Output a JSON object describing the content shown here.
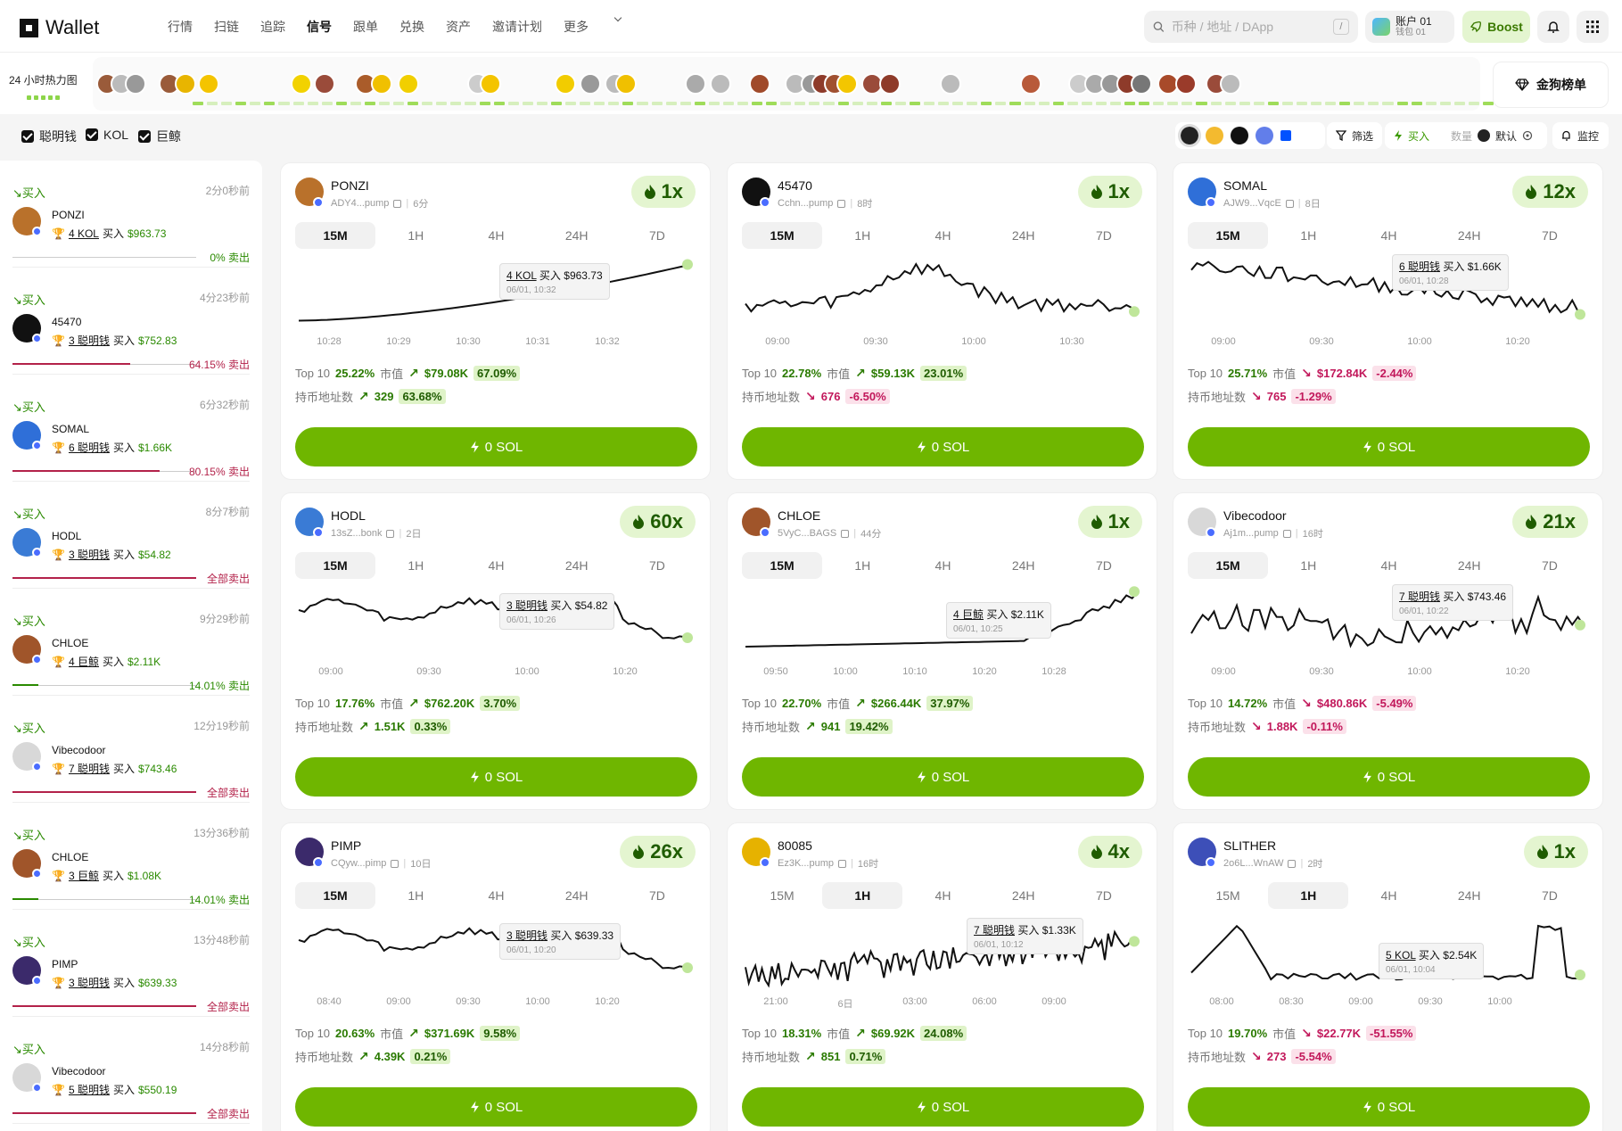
{
  "header": {
    "logo": "OKX",
    "product": "Wallet",
    "nav": [
      "行情",
      "扫链",
      "追踪",
      "信号",
      "跟单",
      "兑换",
      "资产",
      "邀请计划",
      "更多"
    ],
    "active_nav": 3,
    "search_placeholder": "币种 / 地址 / DApp",
    "search_shortcut": "/",
    "account_name": "账户 01",
    "wallet_name": "钱包 01",
    "boost_label": "Boost"
  },
  "heatmap": {
    "label": "24 小时热力图",
    "leaderboard_label": "金狗榜单"
  },
  "filters": {
    "checks": [
      "聪明钱",
      "KOL",
      "巨鲸"
    ],
    "filter_label": "筛选",
    "buy_label": "买入",
    "qty_label": "数量",
    "default_label": "默认",
    "monitor_label": "监控"
  },
  "feed": [
    {
      "buy": "买入",
      "time": "2分0秒前",
      "name": "PONZI",
      "count": "4 KOL",
      "action": "买入",
      "amount": "$963.73",
      "sell": "0% 卖出",
      "fill": 0.0,
      "avatar": "#b9712b"
    },
    {
      "buy": "买入",
      "time": "4分23秒前",
      "name": "45470",
      "count": "3 聪明钱",
      "action": "买入",
      "amount": "$752.83",
      "sell": "64.15% 卖出",
      "fill": 0.64,
      "avatar": "#111111"
    },
    {
      "buy": "买入",
      "time": "6分32秒前",
      "name": "SOMAL",
      "count": "6 聪明钱",
      "action": "买入",
      "amount": "$1.66K",
      "sell": "80.15% 卖出",
      "fill": 0.8,
      "avatar": "#2f6fd8"
    },
    {
      "buy": "买入",
      "time": "8分7秒前",
      "name": "HODL",
      "count": "3 聪明钱",
      "action": "买入",
      "amount": "$54.82",
      "sell": "全部卖出",
      "fill": 1.0,
      "avatar": "#3a7bd5"
    },
    {
      "buy": "买入",
      "time": "9分29秒前",
      "name": "CHLOE",
      "count": "4 巨鲸",
      "action": "买入",
      "amount": "$2.11K",
      "sell": "14.01% 卖出",
      "fill": 0.14,
      "avatar": "#a0552a"
    },
    {
      "buy": "买入",
      "time": "12分19秒前",
      "name": "Vibecodoor",
      "count": "7 聪明钱",
      "action": "买入",
      "amount": "$743.46",
      "sell": "全部卖出",
      "fill": 1.0,
      "avatar": "#d8d8d8"
    },
    {
      "buy": "买入",
      "time": "13分36秒前",
      "name": "CHLOE",
      "count": "3 巨鲸",
      "action": "买入",
      "amount": "$1.08K",
      "sell": "14.01% 卖出",
      "fill": 0.14,
      "avatar": "#a0552a"
    },
    {
      "buy": "买入",
      "time": "13分48秒前",
      "name": "PIMP",
      "count": "3 聪明钱",
      "action": "买入",
      "amount": "$639.33",
      "sell": "全部卖出",
      "fill": 1.0,
      "avatar": "#3b2a6b"
    },
    {
      "buy": "买入",
      "time": "14分8秒前",
      "name": "Vibecodoor",
      "count": "5 聪明钱",
      "action": "买入",
      "amount": "$550.19",
      "sell": "全部卖出",
      "fill": 1.0,
      "avatar": "#d8d8d8"
    }
  ],
  "cards": [
    {
      "name": "PONZI",
      "addr": "ADY4...pump",
      "age": "6分",
      "mult": "1x",
      "tabs": [
        "15M",
        "1H",
        "4H",
        "24H",
        "7D"
      ],
      "tab_on": 0,
      "xticks": [
        "10:28",
        "10:29",
        "10:30",
        "10:31",
        "10:32"
      ],
      "tip_count": "4 KOL",
      "tip_action": "买入",
      "tip_amount": "$963.73",
      "tip_time": "06/01, 10:32",
      "top10": "25.22%",
      "mcap": "$79.08K",
      "mcap_chg": "67.09%",
      "mcap_up": true,
      "holders": "329",
      "holders_chg": "63.68%",
      "holders_up": true,
      "btn": "0 SOL",
      "avatar": "#b9712b",
      "shape": "ponzi"
    },
    {
      "name": "45470",
      "addr": "Cchn...pump",
      "age": "8时",
      "mult": "1x",
      "tabs": [
        "15M",
        "1H",
        "4H",
        "24H",
        "7D"
      ],
      "tab_on": 0,
      "xticks": [
        "09:00",
        "09:30",
        "10:00",
        "10:30"
      ],
      "tip_count": "",
      "tip_action": "",
      "tip_amount": "",
      "tip_time": "",
      "top10": "22.78%",
      "mcap": "$59.13K",
      "mcap_chg": "23.01%",
      "mcap_up": true,
      "holders": "676",
      "holders_chg": "-6.50%",
      "holders_up": false,
      "btn": "0 SOL",
      "avatar": "#111111",
      "shape": "hump"
    },
    {
      "name": "SOMAL",
      "addr": "AJW9...VqcE",
      "age": "8日",
      "mult": "12x",
      "tabs": [
        "15M",
        "1H",
        "4H",
        "24H",
        "7D"
      ],
      "tab_on": 0,
      "xticks": [
        "09:00",
        "09:30",
        "10:00",
        "10:20"
      ],
      "tip_count": "6 聪明钱",
      "tip_action": "买入",
      "tip_amount": "$1.66K",
      "tip_time": "06/01, 10:28",
      "top10": "25.71%",
      "mcap": "$172.84K",
      "mcap_chg": "-2.44%",
      "mcap_up": false,
      "holders": "765",
      "holders_chg": "-1.29%",
      "holders_up": false,
      "btn": "0 SOL",
      "avatar": "#2f6fd8",
      "shape": "decline"
    },
    {
      "name": "HODL",
      "addr": "13sZ...bonk",
      "age": "2日",
      "mult": "60x",
      "tabs": [
        "15M",
        "1H",
        "4H",
        "24H",
        "7D"
      ],
      "tab_on": 0,
      "xticks": [
        "09:00",
        "09:30",
        "10:00",
        "10:20"
      ],
      "tip_count": "3 聪明钱",
      "tip_action": "买入",
      "tip_amount": "$54.82",
      "tip_time": "06/01, 10:26",
      "top10": "17.76%",
      "mcap": "$762.20K",
      "mcap_chg": "3.70%",
      "mcap_up": true,
      "holders": "1.51K",
      "holders_chg": "0.33%",
      "holders_up": true,
      "btn": "0 SOL",
      "avatar": "#3a7bd5",
      "shape": "wavy"
    },
    {
      "name": "CHLOE",
      "addr": "5VyC...BAGS",
      "age": "44分",
      "mult": "1x",
      "tabs": [
        "15M",
        "1H",
        "4H",
        "24H",
        "7D"
      ],
      "tab_on": 0,
      "xticks": [
        "09:50",
        "10:00",
        "10:10",
        "10:20",
        "10:28"
      ],
      "tip_count": "4 巨鲸",
      "tip_action": "买入",
      "tip_amount": "$2.11K",
      "tip_time": "06/01, 10:25",
      "top10": "22.70%",
      "mcap": "$266.44K",
      "mcap_chg": "37.97%",
      "mcap_up": true,
      "holders": "941",
      "holders_chg": "19.42%",
      "holders_up": true,
      "btn": "0 SOL",
      "avatar": "#a0552a",
      "shape": "flatup"
    },
    {
      "name": "Vibecodoor",
      "addr": "Aj1m...pump",
      "age": "16时",
      "mult": "21x",
      "tabs": [
        "15M",
        "1H",
        "4H",
        "24H",
        "7D"
      ],
      "tab_on": 0,
      "xticks": [
        "09:00",
        "09:30",
        "10:00",
        "10:20"
      ],
      "tip_count": "7 聪明钱",
      "tip_action": "买入",
      "tip_amount": "$743.46",
      "tip_time": "06/01, 10:22",
      "top10": "14.72%",
      "mcap": "$480.86K",
      "mcap_chg": "-5.49%",
      "mcap_up": false,
      "holders": "1.88K",
      "holders_chg": "-0.11%",
      "holders_up": false,
      "btn": "0 SOL",
      "avatar": "#d8d8d8",
      "shape": "jag"
    },
    {
      "name": "PIMP",
      "addr": "CQyw...pimp",
      "age": "10日",
      "mult": "26x",
      "tabs": [
        "15M",
        "1H",
        "4H",
        "24H",
        "7D"
      ],
      "tab_on": 0,
      "xticks": [
        "08:40",
        "09:00",
        "09:30",
        "10:00",
        "10:20"
      ],
      "tip_count": "3 聪明钱",
      "tip_action": "买入",
      "tip_amount": "$639.33",
      "tip_time": "06/01, 10:20",
      "top10": "20.63%",
      "mcap": "$371.69K",
      "mcap_chg": "9.58%",
      "mcap_up": true,
      "holders": "4.39K",
      "holders_chg": "0.21%",
      "holders_up": true,
      "btn": "0 SOL",
      "avatar": "#3b2a6b",
      "shape": "wavy"
    },
    {
      "name": "80085",
      "addr": "Ez3K...pump",
      "age": "16时",
      "mult": "4x",
      "tabs": [
        "15M",
        "1H",
        "4H",
        "24H",
        "7D"
      ],
      "tab_on": 1,
      "xticks": [
        "21:00",
        "6日",
        "03:00",
        "06:00",
        "09:00"
      ],
      "tip_count": "7 聪明钱",
      "tip_action": "买入",
      "tip_amount": "$1.33K",
      "tip_time": "06/01, 10:12",
      "top10": "18.31%",
      "mcap": "$69.92K",
      "mcap_chg": "24.08%",
      "mcap_up": true,
      "holders": "851",
      "holders_chg": "0.71%",
      "holders_up": true,
      "btn": "0 SOL",
      "avatar": "#e6b200",
      "shape": "noisy"
    },
    {
      "name": "SLITHER",
      "addr": "2o6L...WnAW",
      "age": "2时",
      "mult": "1x",
      "tabs": [
        "15M",
        "1H",
        "4H",
        "24H",
        "7D"
      ],
      "tab_on": 1,
      "xticks": [
        "08:00",
        "08:30",
        "09:00",
        "09:30",
        "10:00"
      ],
      "tip_count": "5 KOL",
      "tip_action": "买入",
      "tip_amount": "$2.54K",
      "tip_time": "06/01, 10:04",
      "top10": "19.70%",
      "mcap": "$22.77K",
      "mcap_chg": "-51.55%",
      "mcap_up": false,
      "holders": "273",
      "holders_chg": "-5.54%",
      "holders_up": false,
      "btn": "0 SOL",
      "avatar": "#3d4fb8",
      "shape": "spike"
    }
  ],
  "labels": {
    "top10": "Top 10",
    "mcap": "市值",
    "holders": "持币地址数"
  }
}
